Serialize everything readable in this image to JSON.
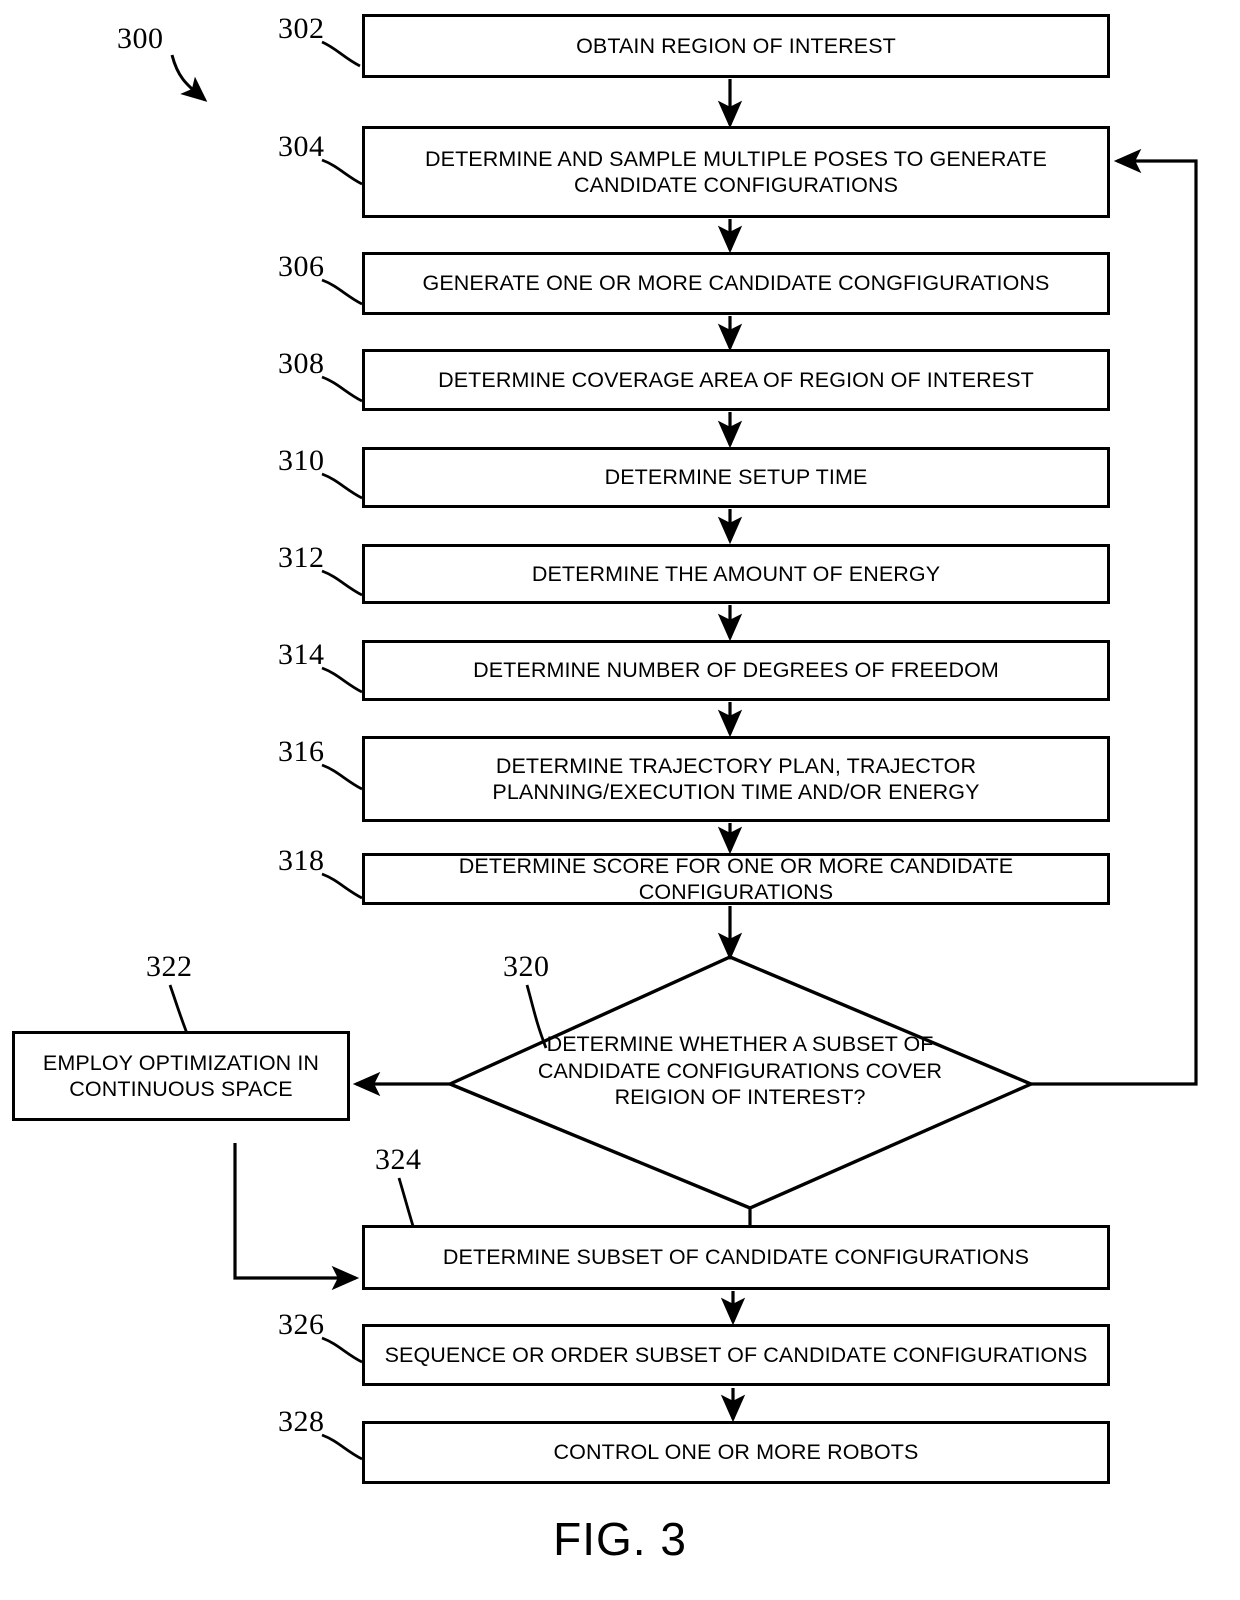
{
  "figure": {
    "caption": "FIG. 3",
    "diagram_ref": "300"
  },
  "nodes": [
    {
      "ref": "302",
      "label": "OBTAIN REGION OF INTEREST"
    },
    {
      "ref": "304",
      "label": "DETERMINE AND SAMPLE MULTIPLE  POSES TO GENERATE CANDIDATE CONFIGURATIONS"
    },
    {
      "ref": "306",
      "label": "GENERATE ONE OR MORE CANDIDATE CONGFIGURATIONS"
    },
    {
      "ref": "308",
      "label": "DETERMINE COVERAGE AREA OF REGION OF INTEREST"
    },
    {
      "ref": "310",
      "label": "DETERMINE SETUP TIME"
    },
    {
      "ref": "312",
      "label": "DETERMINE THE AMOUNT OF ENERGY"
    },
    {
      "ref": "314",
      "label": "DETERMINE NUMBER OF DEGREES OF FREEDOM"
    },
    {
      "ref": "316",
      "label": "DETERMINE TRAJECTORY PLAN, TRAJECTOR PLANNING/EXECUTION TIME AND/OR ENERGY"
    },
    {
      "ref": "318",
      "label": "DETERMINE SCORE FOR ONE OR MORE CANDIDATE CONFIGURATIONS"
    },
    {
      "ref": "320",
      "label": "DETERMINE WHETHER  A SUBSET OF\nCANDIDATE CONFIGURATIONS COVER\nREIGION OF INTEREST?"
    },
    {
      "ref": "322",
      "label": "EMPLOY OPTIMIZATION IN CONTINUOUS SPACE"
    },
    {
      "ref": "324",
      "label": "DETERMINE SUBSET OF CANDIDATE CONFIGURATIONS"
    },
    {
      "ref": "326",
      "label": "SEQUENCE OR ORDER SUBSET OF CANDIDATE CONFIGURATIONS"
    },
    {
      "ref": "328",
      "label": "CONTROL ONE OR MORE ROBOTS"
    }
  ],
  "colors": {
    "stroke": "#000000",
    "background": "#ffffff"
  }
}
